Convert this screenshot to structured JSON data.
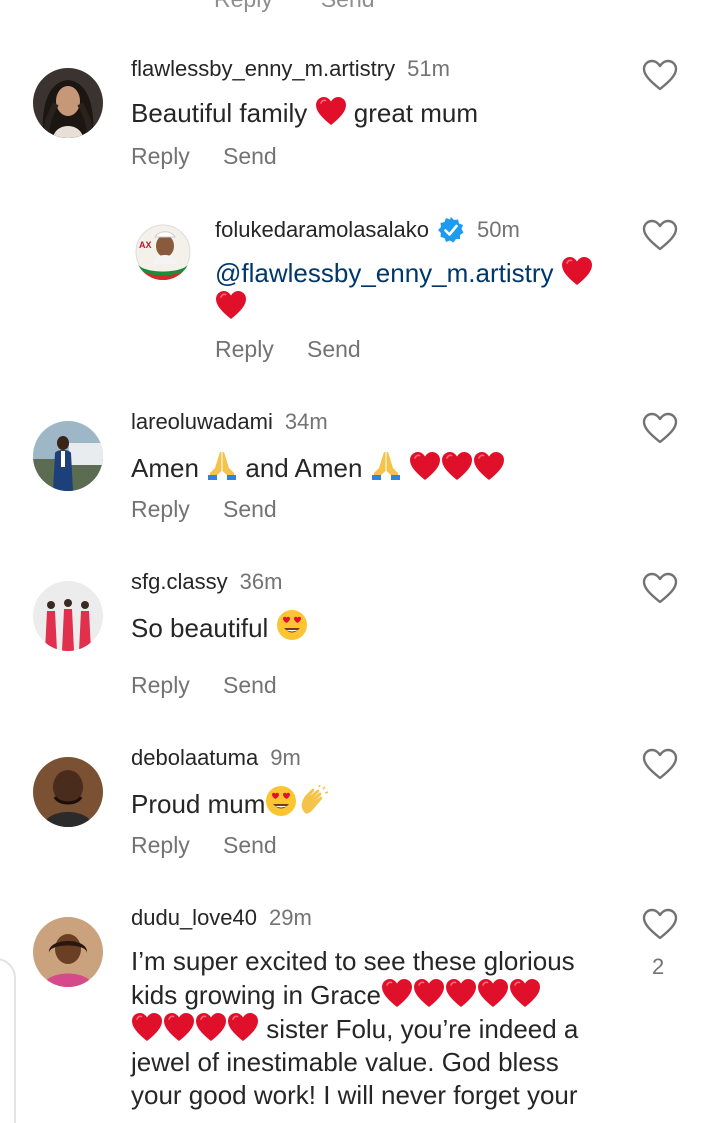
{
  "top_partial": {
    "reply_label": "Reply",
    "send_label": "Send"
  },
  "comments": [
    {
      "username": "flawlessby_enny_m.artistry",
      "time": "51m",
      "text_before": "Beautiful family ",
      "text_after": " great mum",
      "reply_label": "Reply",
      "send_label": "Send"
    },
    {
      "username": "folukedaramolasalako",
      "verified": true,
      "time": "50m",
      "mention": "@flawlessby_enny_m.artistry",
      "reply_label": "Reply",
      "send_label": "Send"
    },
    {
      "username": "lareoluwadami",
      "time": "34m",
      "text_part1": "Amen ",
      "text_part2": " and Amen ",
      "reply_label": "Reply",
      "send_label": "Send"
    },
    {
      "username": "sfg.classy",
      "time": "36m",
      "text_before": "So beautiful ",
      "reply_label": "Reply",
      "send_label": "Send"
    },
    {
      "username": "debolaatuma",
      "time": "9m",
      "text_before": "Proud mum",
      "reply_label": "Reply",
      "send_label": "Send"
    },
    {
      "username": "dudu_love40",
      "time": "29m",
      "line1": "I’m super excited to see these glorious",
      "line2": "kids growing in Grace",
      "line3": " sister Folu, you’re indeed a",
      "line4": "jewel of inestimable value. God bless",
      "line5": "your good work! I will never forget your",
      "like_count": "2"
    }
  ],
  "colors": {
    "username": "#262626",
    "meta": "#737373",
    "mention": "#00376b",
    "verified": "#1d9bf0",
    "heart_emoji": "#e0102b"
  },
  "icons": [
    "heart-outline-icon",
    "verified-badge-icon",
    "red-heart-emoji",
    "folded-hands-emoji",
    "heart-eyes-emoji",
    "clapping-hands-emoji"
  ]
}
